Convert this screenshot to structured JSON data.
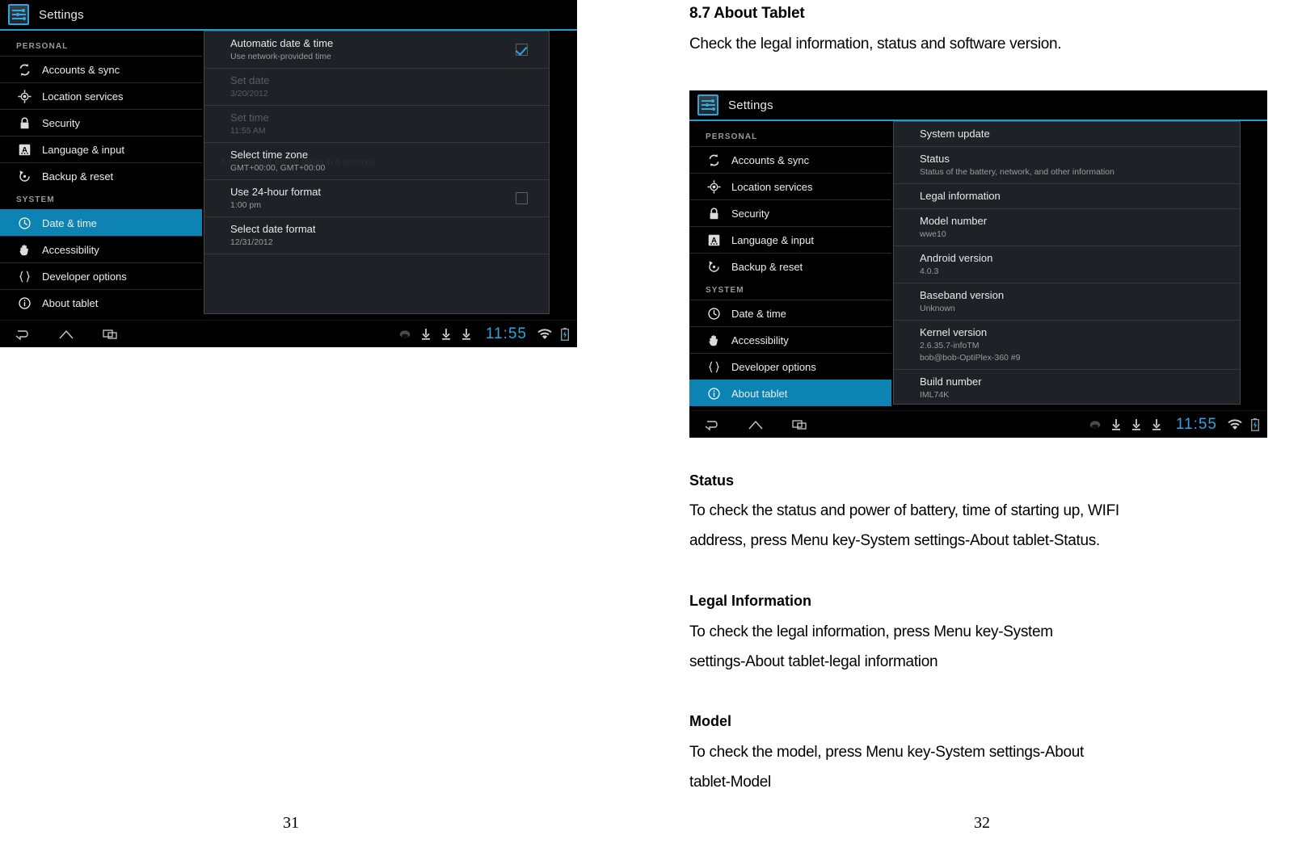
{
  "document": {
    "left_page_number": "31",
    "right_page_number": "32",
    "section_title": "8.7 About Tablet",
    "section_intro": "Check the legal information, status and software version.",
    "blocks": [
      {
        "heading": "Status",
        "lines": [
          "To check the status and power of battery, time of starting up, WIFI",
          "address, press Menu key-System settings-About tablet-Status."
        ]
      },
      {
        "heading": "Legal Information",
        "lines": [
          "To check the legal information, press Menu key-System",
          "settings-About tablet-legal information"
        ]
      },
      {
        "heading": "Model",
        "lines": [
          "To check the model, press Menu key-System settings-About",
          "tablet-Model"
        ]
      }
    ]
  },
  "colors": {
    "accent": "#2aa6e0",
    "selected_row": "#0c83b2",
    "panel_bg": "#1e2126",
    "screen_bg": "#000000"
  },
  "screenshot_left": {
    "app_title": "Settings",
    "app_icon": "settings-sliders-icon",
    "watermark": "A screenshot will be taken in 3 seconds",
    "sidebar": {
      "groups": [
        {
          "label": "PERSONAL",
          "items": [
            {
              "label": "Accounts & sync",
              "icon": "sync-icon",
              "selected": false
            },
            {
              "label": "Location services",
              "icon": "location-icon",
              "selected": false
            },
            {
              "label": "Security",
              "icon": "lock-icon",
              "selected": false
            },
            {
              "label": "Language & input",
              "icon": "keyboard-a-icon",
              "selected": false
            },
            {
              "label": "Backup & reset",
              "icon": "backup-icon",
              "selected": false
            }
          ]
        },
        {
          "label": "SYSTEM",
          "items": [
            {
              "label": "Date & time",
              "icon": "clock-icon",
              "selected": true
            },
            {
              "label": "Accessibility",
              "icon": "hand-icon",
              "selected": false
            },
            {
              "label": "Developer options",
              "icon": "braces-icon",
              "selected": false
            },
            {
              "label": "About tablet",
              "icon": "info-icon",
              "selected": false
            }
          ]
        }
      ]
    },
    "content_rows": [
      {
        "title": "Automatic date & time",
        "subtitle": "Use network-provided time",
        "dim": false,
        "checkbox": "checked"
      },
      {
        "title": "Set date",
        "subtitle": "3/20/2012",
        "dim": true,
        "checkbox": "none"
      },
      {
        "title": "Set time",
        "subtitle": "11:55 AM",
        "dim": true,
        "checkbox": "none"
      },
      {
        "title": "Select time zone",
        "subtitle": "GMT+00:00, GMT+00:00",
        "dim": false,
        "checkbox": "none"
      },
      {
        "title": "Use 24-hour format",
        "subtitle": "1:00 pm",
        "dim": false,
        "checkbox": "unchecked"
      },
      {
        "title": "Select date format",
        "subtitle": "12/31/2012",
        "dim": false,
        "checkbox": "none"
      }
    ],
    "system_bar": {
      "back": "back-icon",
      "home": "home-icon",
      "recents": "recents-icon",
      "clock": "11:55",
      "icons": [
        "usb-icon",
        "download-icon",
        "download-icon",
        "download-icon",
        "wifi-icon",
        "battery-charging-icon"
      ]
    }
  },
  "screenshot_right": {
    "app_title": "Settings",
    "app_icon": "settings-sliders-icon",
    "sidebar": {
      "groups": [
        {
          "label": "PERSONAL",
          "items": [
            {
              "label": "Accounts & sync",
              "icon": "sync-icon",
              "selected": false
            },
            {
              "label": "Location services",
              "icon": "location-icon",
              "selected": false
            },
            {
              "label": "Security",
              "icon": "lock-icon",
              "selected": false
            },
            {
              "label": "Language & input",
              "icon": "keyboard-a-icon",
              "selected": false
            },
            {
              "label": "Backup & reset",
              "icon": "backup-icon",
              "selected": false
            }
          ]
        },
        {
          "label": "SYSTEM",
          "items": [
            {
              "label": "Date & time",
              "icon": "clock-icon",
              "selected": false
            },
            {
              "label": "Accessibility",
              "icon": "hand-icon",
              "selected": false
            },
            {
              "label": "Developer options",
              "icon": "braces-icon",
              "selected": false
            },
            {
              "label": "About tablet",
              "icon": "info-icon",
              "selected": true
            }
          ]
        }
      ]
    },
    "content_rows": [
      {
        "title": "System update",
        "subtitle": "",
        "subtitle2": ""
      },
      {
        "title": "Status",
        "subtitle": "Status of the battery, network, and other information",
        "subtitle2": ""
      },
      {
        "title": "Legal information",
        "subtitle": "",
        "subtitle2": ""
      },
      {
        "title": "Model number",
        "subtitle": "wwe10",
        "subtitle2": ""
      },
      {
        "title": "Android version",
        "subtitle": "4.0.3",
        "subtitle2": ""
      },
      {
        "title": "Baseband version",
        "subtitle": "Unknown",
        "subtitle2": ""
      },
      {
        "title": "Kernel version",
        "subtitle": "2.6.35.7-infoTM",
        "subtitle2": "bob@bob-OptiPlex-360 #9"
      },
      {
        "title": "Build number",
        "subtitle": "IML74K",
        "subtitle2": ""
      }
    ],
    "system_bar": {
      "back": "back-icon",
      "home": "home-icon",
      "recents": "recents-icon",
      "clock": "11:55",
      "icons": [
        "usb-icon",
        "download-icon",
        "download-icon",
        "download-icon",
        "wifi-icon",
        "battery-charging-icon"
      ]
    }
  }
}
